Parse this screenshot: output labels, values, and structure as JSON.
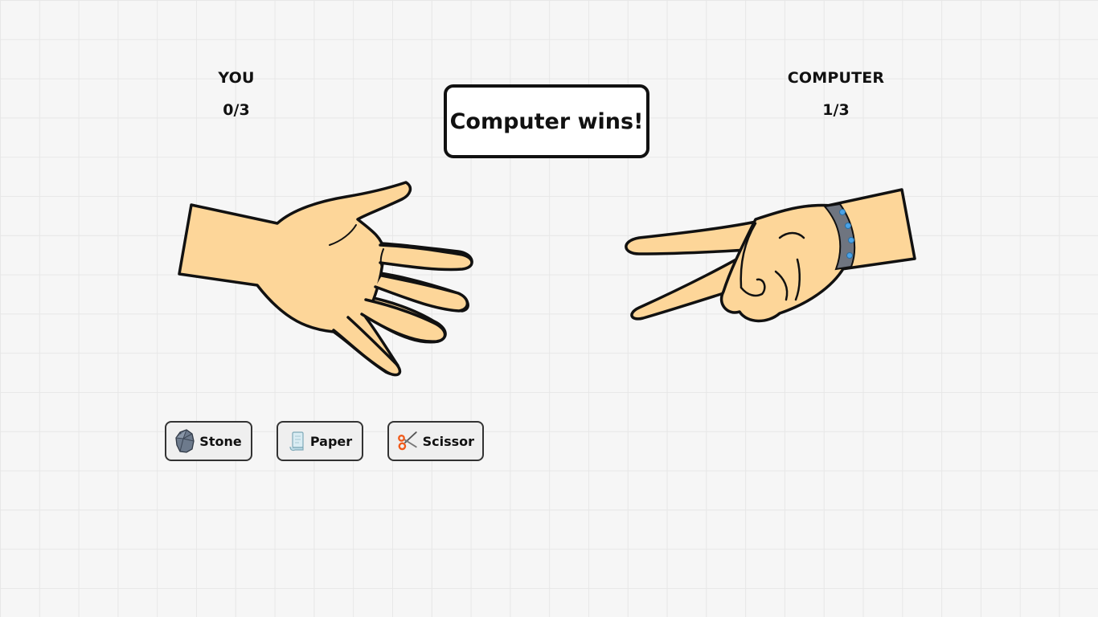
{
  "player": {
    "label": "YOU",
    "score": "0/3"
  },
  "computer": {
    "label": "COMPUTER",
    "score": "1/3"
  },
  "result": {
    "message": "Computer wins!"
  },
  "player_hand": {
    "gesture": "paper",
    "icon": "open-hand-icon"
  },
  "computer_hand": {
    "gesture": "scissor",
    "icon": "peace-hand-icon"
  },
  "choices": [
    {
      "label": "Stone",
      "icon": "rock-icon"
    },
    {
      "label": "Paper",
      "icon": "paper-scroll-icon"
    },
    {
      "label": "Scissor",
      "icon": "scissors-icon"
    }
  ],
  "colors": {
    "skin": "#fdd699",
    "outline": "#111111",
    "bracelet": "#6f7580",
    "bracelet_gem": "#4aa3e8",
    "button_bg": "#efefef",
    "background": "#f6f6f6"
  }
}
